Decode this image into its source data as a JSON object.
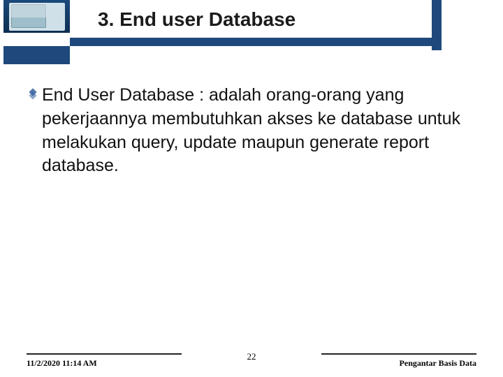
{
  "header": {
    "title": "3. End user Database"
  },
  "body": {
    "bullet_text": "End User Database : adalah orang-orang yang pekerjaannya membutuhkan akses ke database untuk melakukan query, update maupun generate report database."
  },
  "footer": {
    "timestamp": "11/2/2020 11:14 AM",
    "page_number": "22",
    "topic": "Pengantar Basis Data"
  },
  "colors": {
    "accent": "#1f497d"
  }
}
